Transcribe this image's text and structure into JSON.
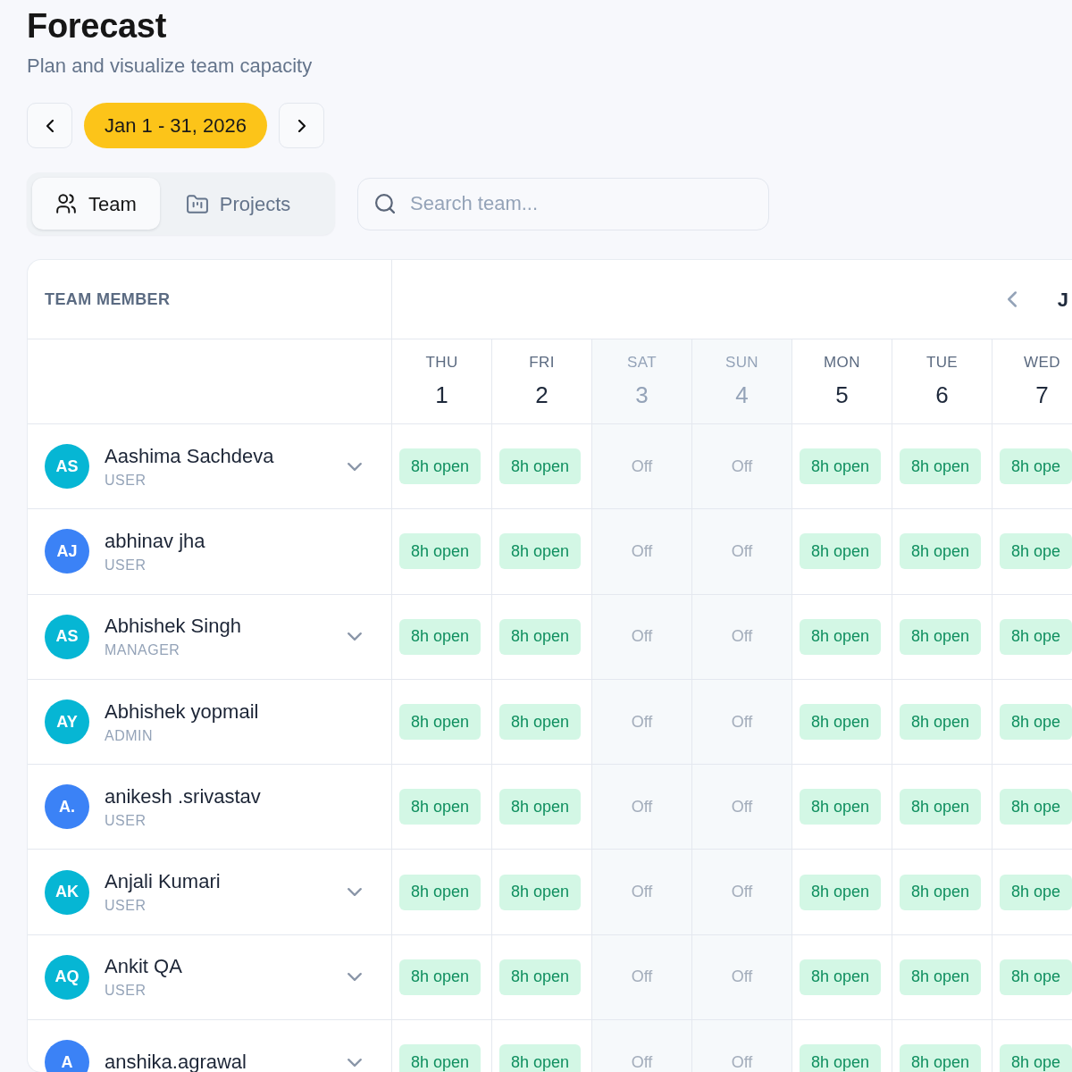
{
  "page": {
    "title": "Forecast",
    "subtitle": "Plan and visualize team capacity"
  },
  "date_range": {
    "label": "Jan 1 - 31, 2026"
  },
  "view_tabs": [
    {
      "kind": "team",
      "label": "Team",
      "selected": true
    },
    {
      "kind": "projects",
      "label": "Projects",
      "selected": false
    }
  ],
  "search": {
    "placeholder": "Search team..."
  },
  "table": {
    "member_heading": "TEAM MEMBER",
    "month_label": "J",
    "days": [
      {
        "weekday": "THU",
        "date": "1",
        "weekend": false
      },
      {
        "weekday": "FRI",
        "date": "2",
        "weekend": false
      },
      {
        "weekday": "SAT",
        "date": "3",
        "weekend": true
      },
      {
        "weekday": "SUN",
        "date": "4",
        "weekend": true
      },
      {
        "weekday": "MON",
        "date": "5",
        "weekend": false
      },
      {
        "weekday": "TUE",
        "date": "6",
        "weekend": false
      },
      {
        "weekday": "WED",
        "date": "7",
        "weekend": false
      }
    ],
    "members": [
      {
        "initials": "AS",
        "color": "#06b6d4",
        "name": "Aashima Sachdeva",
        "role": "USER",
        "expandable": true,
        "cells": [
          {
            "kind": "open",
            "text": "8h open"
          },
          {
            "kind": "open",
            "text": "8h open"
          },
          {
            "kind": "off",
            "text": "Off"
          },
          {
            "kind": "off",
            "text": "Off"
          },
          {
            "kind": "open",
            "text": "8h open"
          },
          {
            "kind": "open",
            "text": "8h open"
          },
          {
            "kind": "open",
            "text": "8h ope"
          }
        ]
      },
      {
        "initials": "AJ",
        "color": "#3b82f6",
        "name": "abhinav jha",
        "role": "USER",
        "expandable": false,
        "cells": [
          {
            "kind": "open",
            "text": "8h open"
          },
          {
            "kind": "open",
            "text": "8h open"
          },
          {
            "kind": "off",
            "text": "Off"
          },
          {
            "kind": "off",
            "text": "Off"
          },
          {
            "kind": "open",
            "text": "8h open"
          },
          {
            "kind": "open",
            "text": "8h open"
          },
          {
            "kind": "open",
            "text": "8h ope"
          }
        ]
      },
      {
        "initials": "AS",
        "color": "#06b6d4",
        "name": "Abhishek Singh",
        "role": "MANAGER",
        "expandable": true,
        "cells": [
          {
            "kind": "open",
            "text": "8h open"
          },
          {
            "kind": "open",
            "text": "8h open"
          },
          {
            "kind": "off",
            "text": "Off"
          },
          {
            "kind": "off",
            "text": "Off"
          },
          {
            "kind": "open",
            "text": "8h open"
          },
          {
            "kind": "open",
            "text": "8h open"
          },
          {
            "kind": "open",
            "text": "8h ope"
          }
        ]
      },
      {
        "initials": "AY",
        "color": "#06b6d4",
        "name": "Abhishek yopmail",
        "role": "ADMIN",
        "expandable": false,
        "cells": [
          {
            "kind": "open",
            "text": "8h open"
          },
          {
            "kind": "open",
            "text": "8h open"
          },
          {
            "kind": "off",
            "text": "Off"
          },
          {
            "kind": "off",
            "text": "Off"
          },
          {
            "kind": "open",
            "text": "8h open"
          },
          {
            "kind": "open",
            "text": "8h open"
          },
          {
            "kind": "open",
            "text": "8h ope"
          }
        ]
      },
      {
        "initials": "A.",
        "color": "#3b82f6",
        "name": "anikesh .srivastav",
        "role": "USER",
        "expandable": false,
        "cells": [
          {
            "kind": "open",
            "text": "8h open"
          },
          {
            "kind": "open",
            "text": "8h open"
          },
          {
            "kind": "off",
            "text": "Off"
          },
          {
            "kind": "off",
            "text": "Off"
          },
          {
            "kind": "open",
            "text": "8h open"
          },
          {
            "kind": "open",
            "text": "8h open"
          },
          {
            "kind": "open",
            "text": "8h ope"
          }
        ]
      },
      {
        "initials": "AK",
        "color": "#06b6d4",
        "name": "Anjali Kumari",
        "role": "USER",
        "expandable": true,
        "cells": [
          {
            "kind": "open",
            "text": "8h open"
          },
          {
            "kind": "open",
            "text": "8h open"
          },
          {
            "kind": "off",
            "text": "Off"
          },
          {
            "kind": "off",
            "text": "Off"
          },
          {
            "kind": "open",
            "text": "8h open"
          },
          {
            "kind": "open",
            "text": "8h open"
          },
          {
            "kind": "open",
            "text": "8h ope"
          }
        ]
      },
      {
        "initials": "AQ",
        "color": "#06b6d4",
        "name": "Ankit QA",
        "role": "USER",
        "expandable": true,
        "cells": [
          {
            "kind": "open",
            "text": "8h open"
          },
          {
            "kind": "open",
            "text": "8h open"
          },
          {
            "kind": "off",
            "text": "Off"
          },
          {
            "kind": "off",
            "text": "Off"
          },
          {
            "kind": "open",
            "text": "8h open"
          },
          {
            "kind": "open",
            "text": "8h open"
          },
          {
            "kind": "open",
            "text": "8h ope"
          }
        ]
      },
      {
        "initials": "A",
        "color": "#3b82f6",
        "name": "anshika.agrawal",
        "expandable": true,
        "cells": [
          {
            "kind": "open",
            "text": "8h open"
          },
          {
            "kind": "open",
            "text": "8h open"
          },
          {
            "kind": "off",
            "text": "Off"
          },
          {
            "kind": "off",
            "text": "Off"
          },
          {
            "kind": "open",
            "text": "8h open"
          },
          {
            "kind": "open",
            "text": "8h open"
          },
          {
            "kind": "open",
            "text": "8h ope"
          }
        ]
      }
    ]
  }
}
